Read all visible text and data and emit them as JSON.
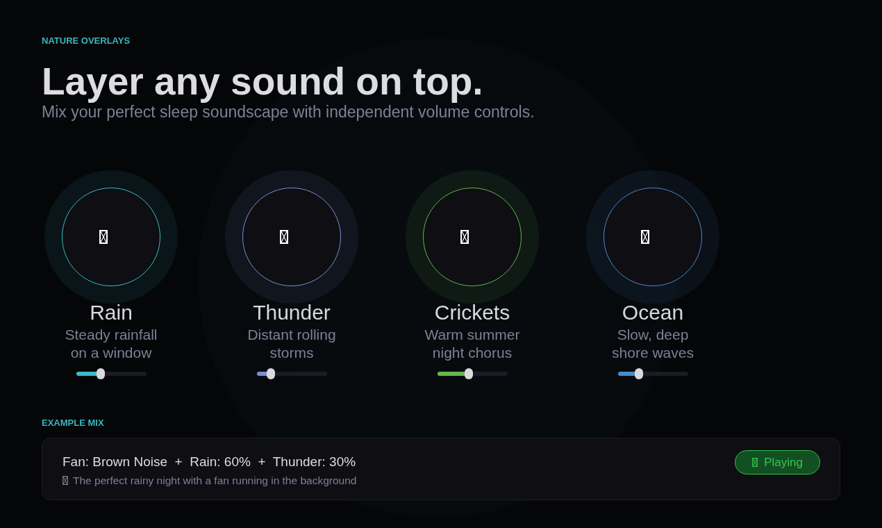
{
  "header": {
    "eyebrow": "NATURE OVERLAYS",
    "title": "Layer any sound on top.",
    "subtitle": "Mix your perfect sleep soundscape with independent volume controls."
  },
  "sounds": [
    {
      "name": "Rain",
      "description": "Steady rainfall on a window",
      "color": "#38bcc6",
      "level": 0.35
    },
    {
      "name": "Thunder",
      "description": "Distant rolling storms",
      "color": "#7b8fd4",
      "level": 0.2
    },
    {
      "name": "Crickets",
      "description": "Warm summer night chorus",
      "color": "#62b84c",
      "level": 0.45
    },
    {
      "name": "Ocean",
      "description": "Slow, deep shore waves",
      "color": "#4a89d0",
      "level": 0.3
    }
  ],
  "example_mix": {
    "heading": "EXAMPLE MIX",
    "mix": "Fan: Brown Noise  +  Rain: 60%  +  Thunder: 30%",
    "note": "The perfect rainy night with a fan running in the background",
    "button": {
      "label": "Playing",
      "active": true
    }
  }
}
